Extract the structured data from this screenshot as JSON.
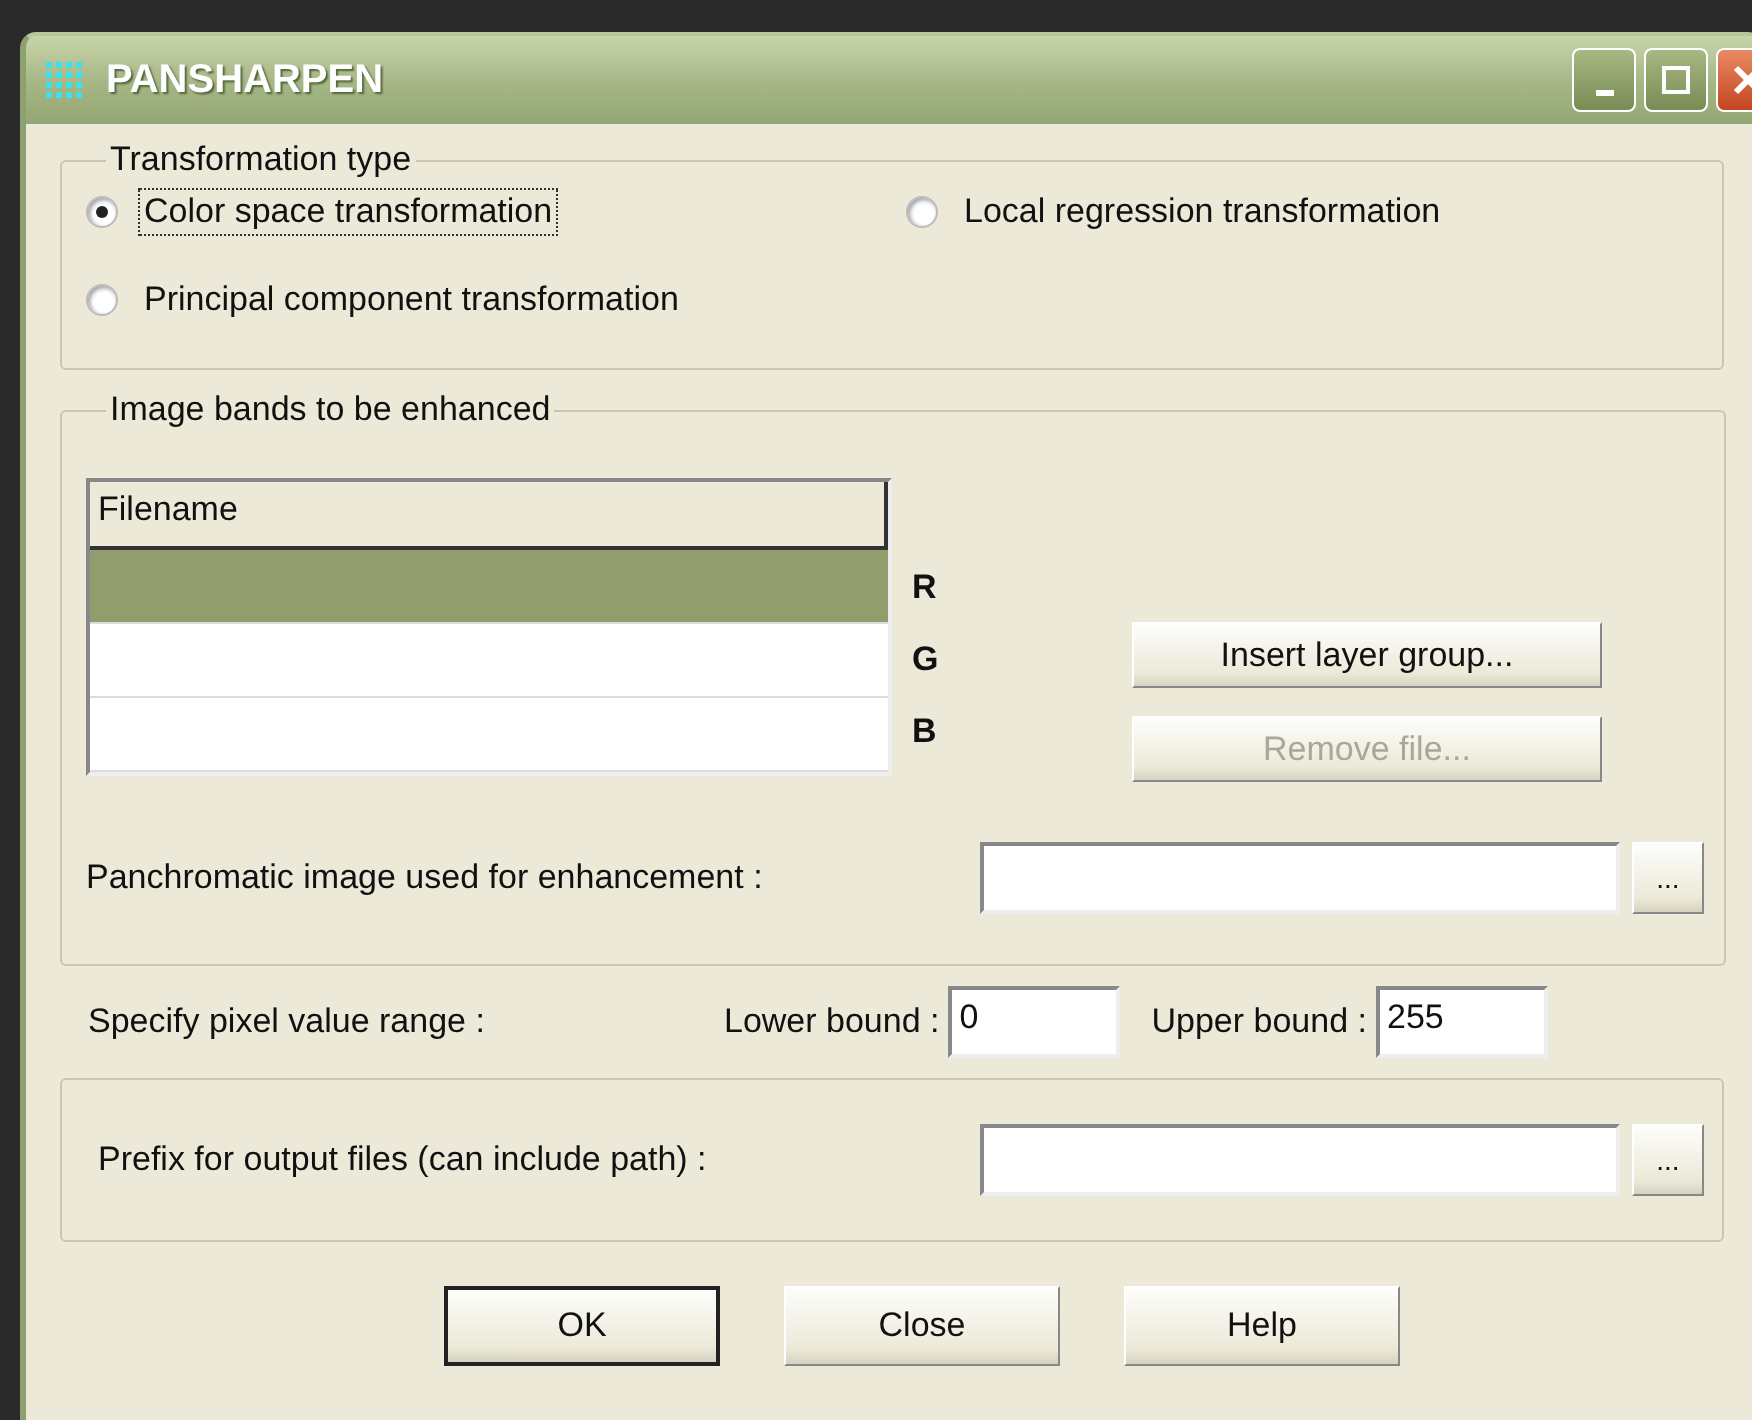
{
  "window": {
    "title": "PANSHARPEN"
  },
  "transformation_type": {
    "label": "Transformation type",
    "options": [
      {
        "label": "Color space transformation",
        "selected": true
      },
      {
        "label": "Local regression transformation",
        "selected": false
      },
      {
        "label": "Principal component transformation",
        "selected": false
      }
    ]
  },
  "bands": {
    "label": "Image bands to be enhanced",
    "table": {
      "columns": [
        "Filename"
      ],
      "rows": [
        {
          "band": "R",
          "selected": true
        },
        {
          "band": "G",
          "selected": false
        },
        {
          "band": "B",
          "selected": false
        }
      ]
    },
    "buttons": [
      {
        "label": "Insert layer group...",
        "disabled": false
      },
      {
        "label": "Remove file...",
        "disabled": true
      }
    ],
    "panchromatic": {
      "label": "Panchromatic image used for enhancement :",
      "browse": "..."
    }
  },
  "pixel_range": {
    "label": "Specify pixel value range :",
    "lower": {
      "label": "Lower bound :",
      "value": "0"
    },
    "upper": {
      "label": "Upper bound :",
      "value": "255"
    }
  },
  "output": {
    "label": "Prefix for output files (can include path) :",
    "browse": "..."
  },
  "buttons": [
    {
      "label": "OK",
      "default": true
    },
    {
      "label": "Close",
      "default": false
    },
    {
      "label": "Help",
      "default": false
    }
  ]
}
